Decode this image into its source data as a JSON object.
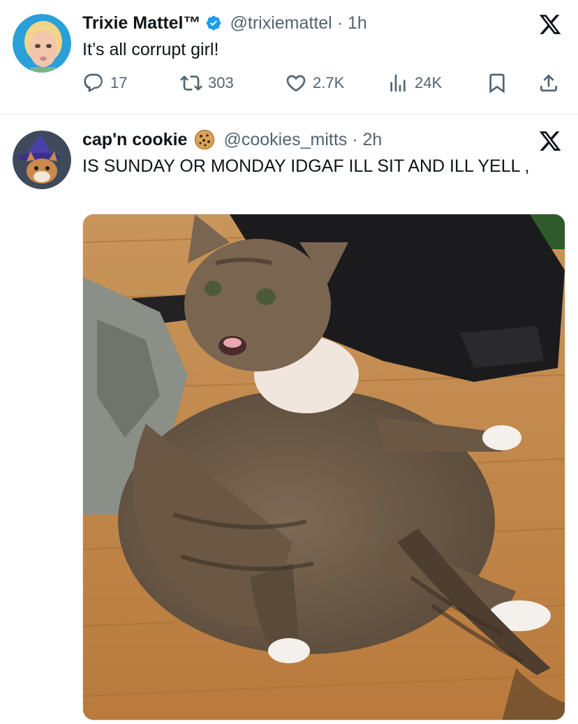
{
  "tweets": [
    {
      "display_name": "Trixie Mattel™",
      "handle_line": "@trixiemattel · 1h",
      "text": "It’s all corrupt girl!",
      "avatar_icon": "avatar-photo-icon",
      "stats": {
        "replies": "17",
        "retweets": "303",
        "likes": "2.7K",
        "views": "24K"
      }
    },
    {
      "display_name": "cap'n cookie",
      "handle_line": "@cookies_mitts · 2h",
      "text": "IS SUNDAY OR MONDAY IDGAF ILL SIT AND ILL YELL ,",
      "avatar_icon": "cat-wizard-avatar-icon",
      "media_icon": "cat-photo"
    }
  ],
  "colors": {
    "text": "#0f1419",
    "secondary": "#536471",
    "verified": "#1d9bf0",
    "divider": "#e6e9ec"
  }
}
